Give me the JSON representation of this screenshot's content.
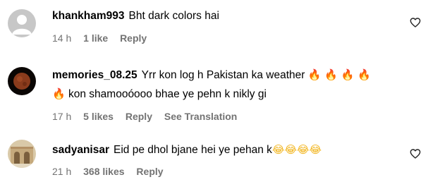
{
  "comments": [
    {
      "username": "khankham993",
      "text": "Bht dark colors hai",
      "time": "14 h",
      "likes": "1 like",
      "reply": "Reply"
    },
    {
      "username": "memories_08.25",
      "text1": "Yrr kon log h Pakistan ka weather",
      "emoji1": "🔥 🔥 🔥 🔥",
      "emoji2": "🔥",
      "text2": "kon shamooóooo bhae ye pehn k nikly gi",
      "time": "17 h",
      "likes": "5 likes",
      "reply": "Reply",
      "translation": "See Translation"
    },
    {
      "username": "sadyanisar",
      "text": "Eid pe dhol bjane hei ye pehan k",
      "emoji": "😂😂😂😂",
      "time": "21 h",
      "likes": "368 likes",
      "reply": "Reply"
    }
  ]
}
